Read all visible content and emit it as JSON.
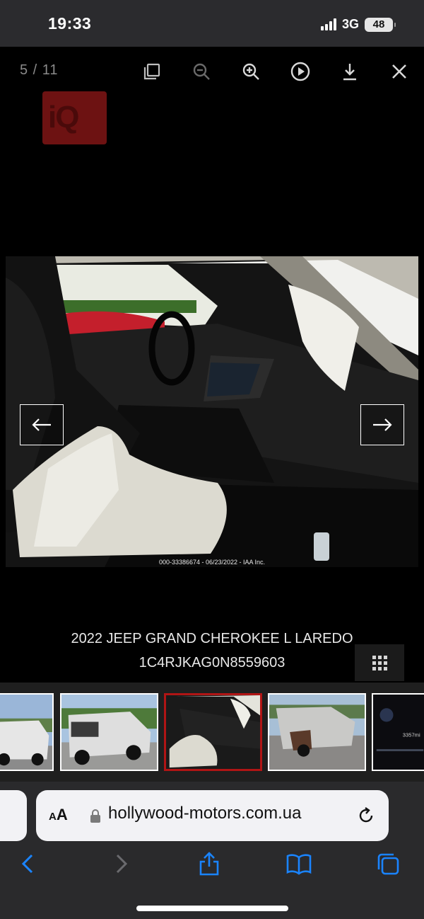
{
  "status_bar": {
    "time": "19:33",
    "network": "3G",
    "battery": "48"
  },
  "viewer": {
    "counter": "5 / 11",
    "tools": [
      "copy-icon",
      "zoom-out-icon",
      "zoom-in-icon",
      "play-icon",
      "download-icon",
      "close-icon"
    ]
  },
  "logo": {
    "text": "iQ"
  },
  "photo": {
    "watermark": "000-33386674 - 06/23/2022 - IAA Inc."
  },
  "caption": {
    "title": "2022 JEEP GRAND CHEROKEE L LAREDO",
    "vin": "1C4RJKAG0N8559603"
  },
  "thumbnails": {
    "active_index": 2,
    "count_visible": 5,
    "odometer_fragment": "3357mi"
  },
  "safari": {
    "text_size_label": "AA",
    "url": "hollywood-motors.com.ua"
  },
  "colors": {
    "accent_active_thumb": "#b01515",
    "ios_blue": "#1a84ff",
    "logo_red": "#6d1212"
  }
}
